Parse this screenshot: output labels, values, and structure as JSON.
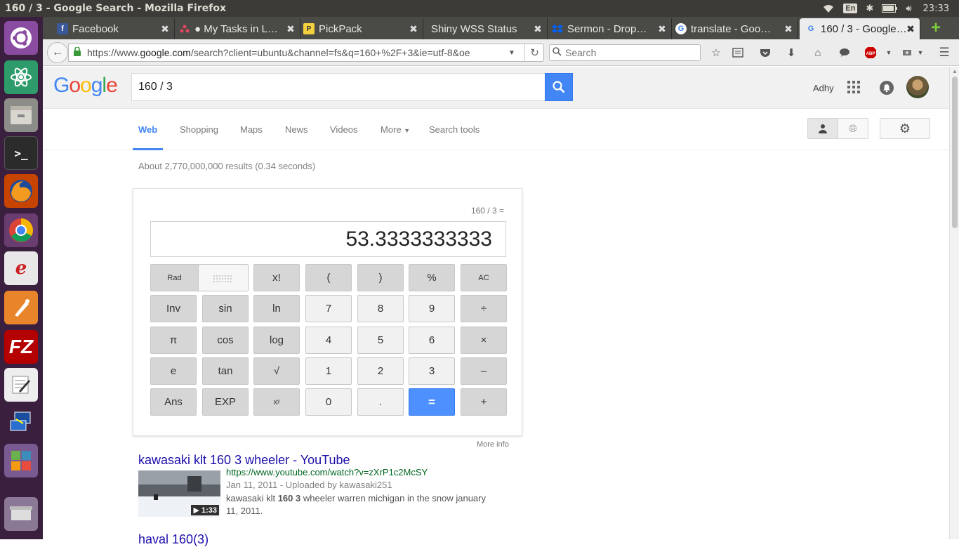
{
  "system": {
    "window_title": "160 / 3 - Google Search - Mozilla Firefox",
    "keyboard_layout": "En",
    "clock": "23:33",
    "tray_icons": [
      "wifi-icon",
      "bluetooth-icon",
      "battery-icon",
      "volume-icon"
    ]
  },
  "launcher": {
    "items": [
      "ubuntu-dash-icon",
      "atom-icon",
      "files-icon",
      "terminal-icon",
      "firefox-icon",
      "chrome-icon",
      "evince-icon",
      "inkscape-icon",
      "filezilla-icon",
      "text-editor-icon",
      "remmina-icon",
      "workspace-switcher-icon",
      "trash-icon"
    ]
  },
  "tabs": [
    {
      "label": "Facebook",
      "favicon": "facebook-icon",
      "color": "#3b5998"
    },
    {
      "label": "● My Tasks in L…",
      "favicon": "asana-icon",
      "color": "#e8465f"
    },
    {
      "label": "PickPack",
      "favicon": "pickpack-icon",
      "color": "#f4d03f"
    },
    {
      "label": "Shiny WSS Status",
      "favicon": "",
      "color": ""
    },
    {
      "label": "Sermon - Drop…",
      "favicon": "dropbox-icon",
      "color": "#0061fe"
    },
    {
      "label": "translate - Goo…",
      "favicon": "google-icon",
      "color": "#4285f4"
    },
    {
      "label": "160 / 3 - Google…",
      "favicon": "google-icon",
      "color": "#4285f4",
      "active": true
    }
  ],
  "navbar": {
    "url_prefix": "https://www.",
    "url_domain": "google.com",
    "url_rest": "/search?client=ubuntu&channel=fs&q=160+%2F+3&ie=utf-8&oe",
    "search_placeholder": "Search"
  },
  "google": {
    "logo": "Google",
    "query": "160 / 3",
    "user_name": "Adhy",
    "nav": [
      "Web",
      "Shopping",
      "Maps",
      "News",
      "Videos",
      "More",
      "Search tools"
    ],
    "active_nav": "Web",
    "stats": "About 2,770,000,000 results (0.34 seconds)",
    "more_info": "More info"
  },
  "calculator": {
    "expression": "160 / 3 =",
    "result": "53.3333333333",
    "rad_label": "Rad",
    "deg_label": "Deg",
    "row1": [
      "x!",
      "(",
      ")",
      "%",
      "AC"
    ],
    "row2": [
      "Inv",
      "sin",
      "ln",
      "7",
      "8",
      "9",
      "÷"
    ],
    "row3": [
      "π",
      "cos",
      "log",
      "4",
      "5",
      "6",
      "×"
    ],
    "row4": [
      "e",
      "tan",
      "√",
      "1",
      "2",
      "3",
      "–"
    ],
    "row5": [
      "Ans",
      "EXP",
      "xʸ",
      "0",
      ".",
      "=",
      "+"
    ]
  },
  "results": [
    {
      "title": "kawasaki klt 160 3 wheeler - YouTube",
      "url": "https://www.youtube.com/watch?v=zXrP1c2McSY",
      "meta": "Jan 11, 2011 - Uploaded by kawasaki251",
      "snippet_pre": "kawasaki klt ",
      "snippet_bold": "160 3",
      "snippet_post": " wheeler warren michigan in the snow january 11, 2011.",
      "duration": "▶ 1:33"
    },
    {
      "title": "haval 160(3)"
    }
  ]
}
